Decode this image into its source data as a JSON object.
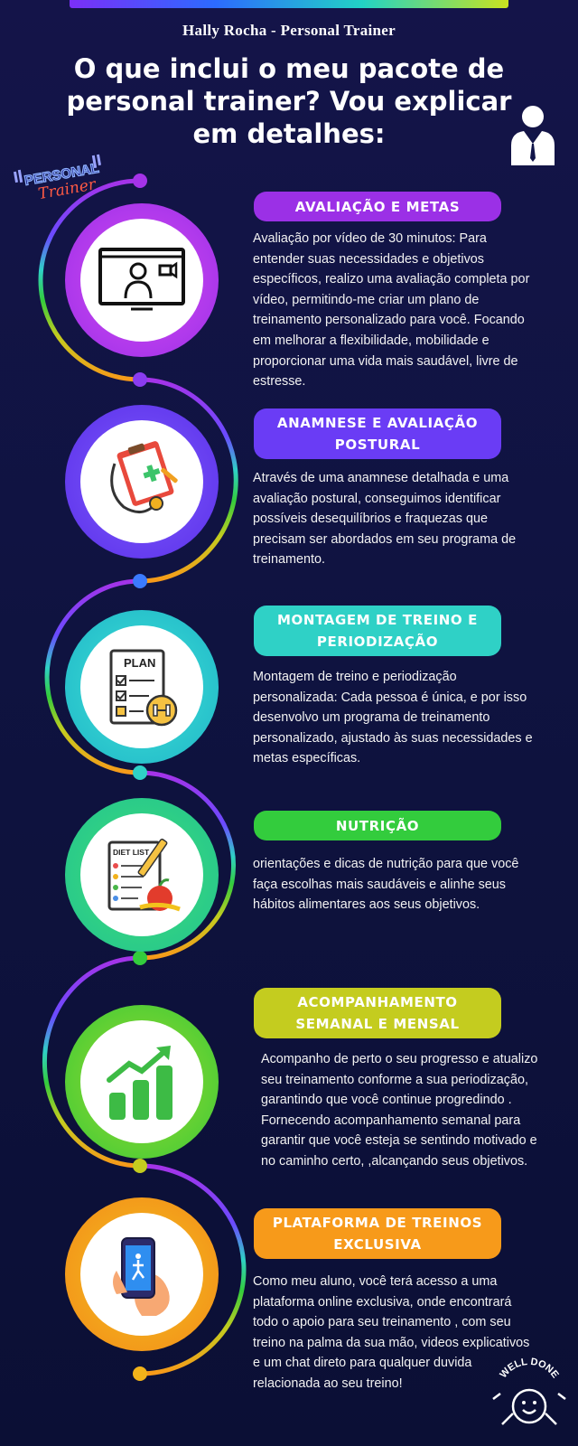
{
  "header": {
    "subtitle": "Hally Rocha - Personal Trainer",
    "title": "O que inclui o meu pacote de personal trainer? Vou explicar em detalhes:"
  },
  "sticker": {
    "line1": "PERSONAL",
    "line2": "Trainer"
  },
  "colors": {
    "background": "#11154a",
    "purple": "#a533e8",
    "violet": "#6a4bff",
    "teal": "#2fd1c6",
    "green": "#33cc3d",
    "olive": "#c4cc1f",
    "orange": "#f79a1a"
  },
  "sections": [
    {
      "title": "AVALIAÇÃO E METAS",
      "icon": "video-call-icon",
      "text": "Avaliação por vídeo de 30 minutos: Para entender suas necessidades e objetivos específicos, realizo uma avaliação completa por vídeo, permitindo-me criar um plano de treinamento personalizado para você. Focando em melhorar a flexibilidade, mobilidade e proporcionar uma vida mais saudável, livre de estresse."
    },
    {
      "title": "ANAMNESE E AVALIAÇÃO POSTURAL",
      "icon": "clipboard-stethoscope-icon",
      "text": " Através de uma anamnese detalhada e uma avaliação postural, conseguimos identificar possíveis desequilíbrios e fraquezas que precisam ser abordados em seu programa de treinamento."
    },
    {
      "title": "MONTAGEM DE TREINO E PERIODIZAÇÃO",
      "icon": "plan-checklist-icon",
      "icon_label": "PLAN",
      "text": "Montagem de treino e periodização personalizada: Cada pessoa é única, e por isso desenvolvo um programa de treinamento personalizado, ajustado às suas necessidades e metas específicas."
    },
    {
      "title": "NUTRIÇÃO",
      "icon": "diet-list-icon",
      "icon_label": "DIET LIST",
      "text": "orientações e dicas de nutrição para que você faça escolhas mais saudáveis e alinhe seus hábitos alimentares aos seus objetivos."
    },
    {
      "title": "ACOMPANHAMENTO SEMANAL E MENSAL",
      "icon": "growth-chart-icon",
      "text": "Acompanho de perto o seu progresso e atualizo seu treinamento conforme a sua periodização, garantindo que você continue progredindo . Fornecendo acompanhamento semanal para garantir que você esteja se sentindo motivado e no caminho certo, ,alcançando seus objetivos."
    },
    {
      "title": "PLATAFORMA DE TREINOS EXCLUSIVA",
      "icon": "phone-app-icon",
      "text": "Como meu aluno, você terá acesso a uma plataforma online exclusiva, onde encontrará todo o apoio para seu treinamento , com  seu treino na palma da sua mão, videos explicativos e um chat direto para qualquer duvida relacionada ao seu treino!"
    }
  ],
  "footer": {
    "badge": "WELL DONE"
  }
}
